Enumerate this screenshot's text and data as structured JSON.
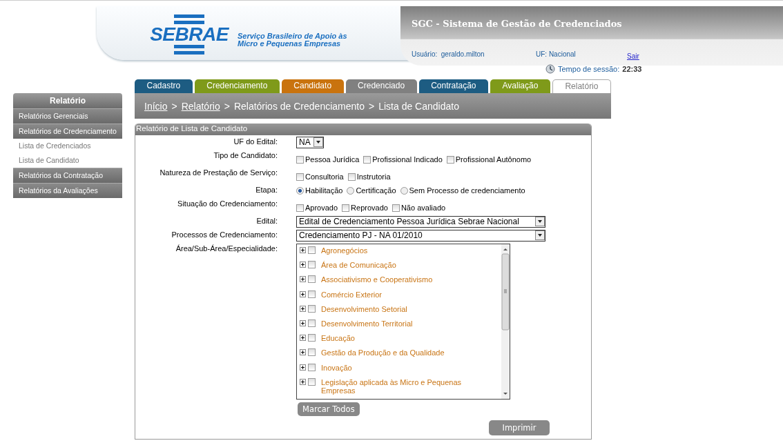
{
  "header": {
    "logo": "SEBRAE",
    "logo_tagline": "Serviço Brasileiro de Apoio às Micro e Pequenas Empresas",
    "system_title": "SGC - Sistema de Gestão de Credenciados",
    "user_label": "Usuário:",
    "user": "geraldo.milton",
    "uf": "UF: Nacional",
    "logout": "Sair",
    "session_label": "Tempo de sessão:",
    "session_time": "22:33"
  },
  "tabs": [
    {
      "label": "Cadastro",
      "color": "#1d5c82",
      "selected": false
    },
    {
      "label": "Credenciamento",
      "color": "#7f9a1a",
      "selected": false
    },
    {
      "label": "Candidato",
      "color": "#c9730e",
      "selected": false
    },
    {
      "label": "Credenciado",
      "color": "#808080",
      "selected": false
    },
    {
      "label": "Contratação",
      "color": "#1d5c82",
      "selected": false
    },
    {
      "label": "Avaliação",
      "color": "#7f9a1a",
      "selected": false
    },
    {
      "label": "Relatório",
      "color": "#808080",
      "selected": true
    }
  ],
  "sidebar": {
    "title": "Relatório",
    "items": [
      {
        "label": "Relatórios Gerenciais",
        "kind": "group"
      },
      {
        "label": "Relatórios de Credenciamento",
        "kind": "group"
      },
      {
        "label": "Lista de Credenciados",
        "kind": "link"
      },
      {
        "label": "Lista de Candidato",
        "kind": "link"
      },
      {
        "label": "Relatórios da Contratação",
        "kind": "group"
      },
      {
        "label": "Relatórios da Avaliações",
        "kind": "group"
      }
    ]
  },
  "breadcrumb": [
    {
      "label": "Início",
      "kind": "link"
    },
    {
      "label": ">",
      "kind": "separator"
    },
    {
      "label": "Relatório",
      "kind": "link"
    },
    {
      "label": ">",
      "kind": "separator"
    },
    {
      "label": "Relatórios de Credenciamento",
      "kind": "text"
    },
    {
      "label": ">",
      "kind": "separator"
    },
    {
      "label": "Lista de Candidato",
      "kind": "text"
    }
  ],
  "panel": {
    "title": "Relatório de Lista de Candidato",
    "fields": [
      {
        "kind": "select",
        "label": "UF do Edital:",
        "value": "NA"
      },
      {
        "kind": "checkboxes",
        "label": "Tipo de Candidato:",
        "options": [
          {
            "label": "Pessoa Jurídica",
            "checked": false
          },
          {
            "label": "Profissional Indicado",
            "checked": false
          },
          {
            "label": "Profissional Autônomo",
            "checked": false
          }
        ]
      },
      {
        "kind": "checkboxes",
        "label": "Natureza de Prestação de Serviço:",
        "options": [
          {
            "label": "Consultoria",
            "checked": false
          },
          {
            "label": "Instrutoria",
            "checked": false
          }
        ]
      },
      {
        "kind": "radios",
        "label": "Etapa:",
        "options": [
          {
            "label": "Habilitação",
            "selected": true
          },
          {
            "label": "Certificação",
            "selected": false
          },
          {
            "label": "Sem Processo de credenciamento",
            "selected": false
          }
        ]
      },
      {
        "kind": "checkboxes",
        "label": "Situação do Credenciamento:",
        "options": [
          {
            "label": "Aprovado",
            "checked": false
          },
          {
            "label": "Reprovado",
            "checked": false
          },
          {
            "label": "Não avaliado",
            "checked": false
          }
        ]
      },
      {
        "kind": "select",
        "label": "Edital:",
        "value": "Edital de Credenciamento Pessoa Jurídica Sebrae Nacional"
      },
      {
        "kind": "select",
        "label": "Processos de Credenciamento:",
        "value": "Credenciamento PJ - NA 01/2010"
      },
      {
        "kind": "tree",
        "label": "Área/Sub-Área/Especialidade:",
        "items": [
          {
            "label": "Agronegócios",
            "expanded": false,
            "checked": false
          },
          {
            "label": "Área de Comunicação",
            "expanded": false,
            "checked": false
          },
          {
            "label": "Associativismo e Cooperativismo",
            "expanded": false,
            "checked": false
          },
          {
            "label": "Comércio Exterior",
            "expanded": false,
            "checked": false
          },
          {
            "label": "Desenvolvimento Setorial",
            "expanded": false,
            "checked": false
          },
          {
            "label": "Desenvolvimento Territorial",
            "expanded": false,
            "checked": false
          },
          {
            "label": "Educação",
            "expanded": false,
            "checked": false
          },
          {
            "label": "Gestão da Produção e da Qualidade",
            "expanded": false,
            "checked": false
          },
          {
            "label": "Inovação",
            "expanded": false,
            "checked": false
          },
          {
            "label": "Legislação aplicada às Micro e Pequenas Empresas",
            "expanded": false,
            "checked": false
          }
        ],
        "button": "Marcar Todos"
      }
    ],
    "print_button": "Imprimir"
  }
}
